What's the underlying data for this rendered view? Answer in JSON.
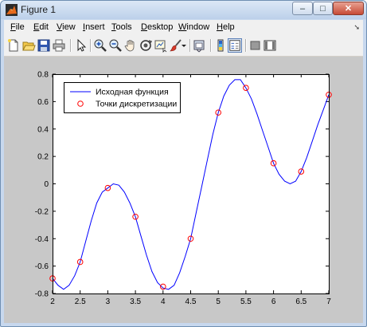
{
  "window": {
    "title": "Figure 1",
    "controls": {
      "minimize": "–",
      "maximize": "□",
      "close": "✕"
    }
  },
  "menu": {
    "items": [
      {
        "label": "File",
        "mnemonic": "F",
        "rest": "ile"
      },
      {
        "label": "Edit",
        "mnemonic": "E",
        "rest": "dit"
      },
      {
        "label": "View",
        "mnemonic": "V",
        "rest": "iew"
      },
      {
        "label": "Insert",
        "mnemonic": "I",
        "rest": "nsert"
      },
      {
        "label": "Tools",
        "mnemonic": "T",
        "rest": "ools"
      },
      {
        "label": "Desktop",
        "mnemonic": "D",
        "rest": "esktop"
      },
      {
        "label": "Window",
        "mnemonic": "W",
        "rest": "indow"
      },
      {
        "label": "Help",
        "mnemonic": "H",
        "rest": "elp"
      }
    ]
  },
  "toolbar": {
    "buttons": [
      "new-figure-icon",
      "open-file-icon",
      "save-icon",
      "print-icon",
      "edit-plot-arrow-icon",
      "zoom-in-icon",
      "zoom-out-icon",
      "pan-hand-icon",
      "rotate-3d-icon",
      "data-cursor-icon",
      "brush-icon",
      "brush-dropdown-icon",
      "link-plot-icon",
      "colorbar-icon",
      "legend-icon",
      "hide-plot-tools-icon",
      "show-plot-tools-icon"
    ]
  },
  "chart_data": {
    "type": "line",
    "title": "",
    "xlabel": "",
    "ylabel": "",
    "xlim": [
      2,
      7
    ],
    "ylim": [
      -0.8,
      0.8
    ],
    "xticks": [
      "2",
      "2.5",
      "3",
      "3.5",
      "4",
      "4.5",
      "5",
      "5.5",
      "6",
      "6.5",
      "7"
    ],
    "yticks": [
      "0.8",
      "0.6",
      "0.4",
      "0.2",
      "0",
      "-0.2",
      "-0.4",
      "-0.6",
      "-0.8"
    ],
    "legend_position": "top-left",
    "series": [
      {
        "name": "Исходная функция",
        "style": "line",
        "color": "#0000ff",
        "x": [
          2.0,
          2.1,
          2.2,
          2.3,
          2.4,
          2.5,
          2.6,
          2.7,
          2.8,
          2.9,
          3.0,
          3.1,
          3.2,
          3.3,
          3.4,
          3.5,
          3.6,
          3.7,
          3.8,
          3.9,
          4.0,
          4.1,
          4.2,
          4.3,
          4.4,
          4.5,
          4.6,
          4.7,
          4.8,
          4.9,
          5.0,
          5.1,
          5.2,
          5.3,
          5.4,
          5.5,
          5.6,
          5.7,
          5.8,
          5.9,
          6.0,
          6.1,
          6.2,
          6.3,
          6.4,
          6.5,
          6.6,
          6.7,
          6.8,
          6.9,
          7.0
        ],
        "y": [
          -0.69,
          -0.74,
          -0.77,
          -0.74,
          -0.67,
          -0.57,
          -0.42,
          -0.27,
          -0.14,
          -0.06,
          -0.03,
          0.0,
          -0.01,
          -0.06,
          -0.14,
          -0.24,
          -0.38,
          -0.52,
          -0.64,
          -0.72,
          -0.76,
          -0.77,
          -0.74,
          -0.65,
          -0.53,
          -0.4,
          -0.21,
          -0.02,
          0.17,
          0.36,
          0.52,
          0.64,
          0.72,
          0.76,
          0.76,
          0.7,
          0.62,
          0.51,
          0.39,
          0.27,
          0.15,
          0.07,
          0.02,
          0.0,
          0.02,
          0.09,
          0.19,
          0.31,
          0.43,
          0.54,
          0.65
        ]
      },
      {
        "name": "Точки дискретизации",
        "style": "marker",
        "color": "#ff0000",
        "x": [
          2.0,
          2.5,
          3.0,
          3.5,
          4.0,
          4.5,
          5.0,
          5.5,
          6.0,
          6.5,
          7.0
        ],
        "y": [
          -0.69,
          -0.57,
          -0.03,
          -0.24,
          -0.75,
          -0.4,
          0.52,
          0.7,
          0.15,
          0.09,
          0.65
        ]
      }
    ]
  }
}
